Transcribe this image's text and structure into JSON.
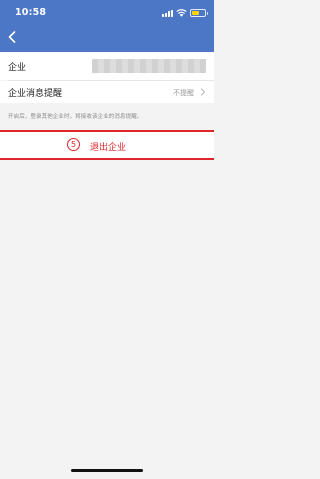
{
  "status_bar": {
    "time": "10:58",
    "battery_level": 0.6,
    "battery_color": "#ffd400"
  },
  "header": {
    "back_icon": "chevron-left-icon",
    "color": "#4c76c6"
  },
  "enterprise_row": {
    "label": "企业"
  },
  "reminder_row": {
    "label": "企业消息提醒",
    "status": "不提醒"
  },
  "hint_text": "开启后，登录其他企业时，将接收该企业的消息提醒。",
  "exit_button": {
    "number": "5",
    "label": "退出企业",
    "accent_color": "#e0262a"
  }
}
